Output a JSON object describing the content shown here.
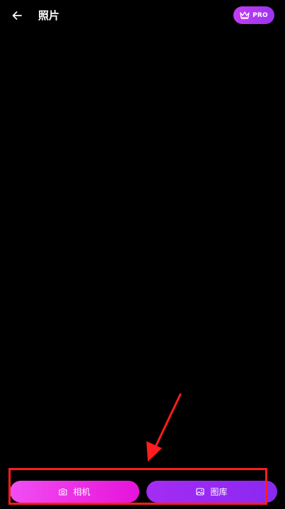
{
  "header": {
    "title": "照片",
    "back_icon": "arrow-left-icon",
    "pro_badge": {
      "label": "PRO",
      "icon": "crown-icon"
    }
  },
  "actions": {
    "camera": {
      "label": "相机",
      "icon": "camera-icon"
    },
    "gallery": {
      "label": "图库",
      "icon": "image-icon"
    }
  },
  "colors": {
    "background": "#000000",
    "pro_gradient_start": "#c43cf2",
    "pro_gradient_end": "#9a35f0",
    "camera_gradient_start": "#f14ef3",
    "camera_gradient_end": "#e613d9",
    "gallery_gradient_start": "#a42cf3",
    "gallery_gradient_end": "#8a28f2",
    "annotation": "#ff1d1d"
  }
}
